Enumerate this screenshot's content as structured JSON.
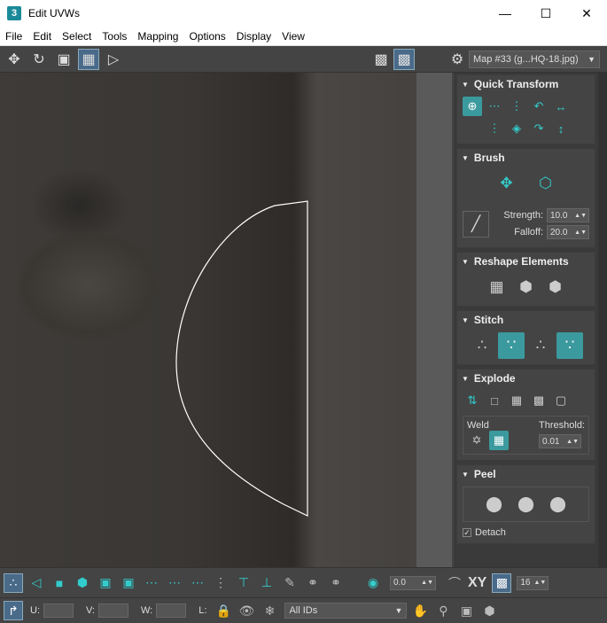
{
  "window": {
    "title": "Edit UVWs",
    "controls": [
      "minimize",
      "maximize",
      "close"
    ]
  },
  "menu": [
    "File",
    "Edit",
    "Select",
    "Tools",
    "Mapping",
    "Options",
    "Display",
    "View"
  ],
  "toolbar": {
    "uv_label": "U V",
    "map_select": "Map #33 (g...HQ-18.jpg)"
  },
  "rollouts": {
    "quick_transform": {
      "title": "Quick Transform"
    },
    "brush": {
      "title": "Brush",
      "strength_label": "Strength:",
      "strength_value": "10.0",
      "falloff_label": "Falloff:",
      "falloff_value": "20.0"
    },
    "reshape": {
      "title": "Reshape Elements"
    },
    "stitch": {
      "title": "Stitch"
    },
    "explode": {
      "title": "Explode",
      "weld_label": "Weld",
      "threshold_label": "Threshold:",
      "threshold_value": "0.01"
    },
    "peel": {
      "title": "Peel",
      "detach_label": "Detach",
      "detach_checked": true
    }
  },
  "bottom": {
    "angle_value": "0.0",
    "xy_label": "XY",
    "grid_value": "16",
    "u_label": "U:",
    "v_label": "V:",
    "w_label": "W:",
    "l_label": "L:",
    "ids_select": "All IDs"
  },
  "colors": {
    "accent": "#33c6c6",
    "panel": "#444444",
    "active": "#4a6a8a"
  }
}
